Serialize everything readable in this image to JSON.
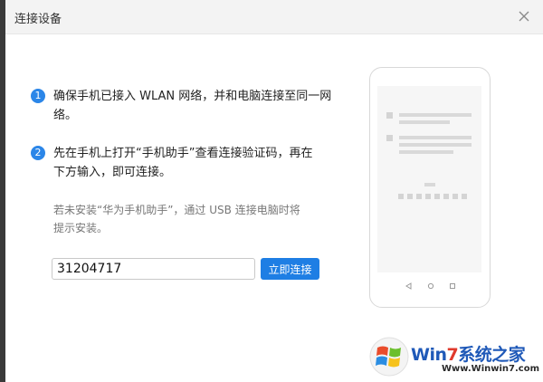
{
  "dialog": {
    "title": "连接设备",
    "steps": [
      {
        "num": "1",
        "line1": "确保手机已接入 WLAN 网络，并和电脑连接至同一网",
        "line2": "络。"
      },
      {
        "num": "2",
        "line1": "先在手机上打开“手机助手”查看连接验证码，再在",
        "line2": "下方输入，即可连接。"
      }
    ],
    "hint": {
      "line1": "若未安装“华为手机助手”，通过 USB 连接电脑时将",
      "line2": "提示安装。"
    },
    "code_input": {
      "value": "31204717"
    },
    "connect_label": "立即连接",
    "icons": {
      "close": "close-icon",
      "phone": "phone-illustration"
    }
  },
  "watermark": {
    "brand_win": "Win",
    "brand_seven": "7",
    "brand_rest": "系统之家",
    "url": "Www.Winwin7.com"
  },
  "colors": {
    "accent": "#1e7ee4",
    "step_badge": "#2b86e8"
  }
}
